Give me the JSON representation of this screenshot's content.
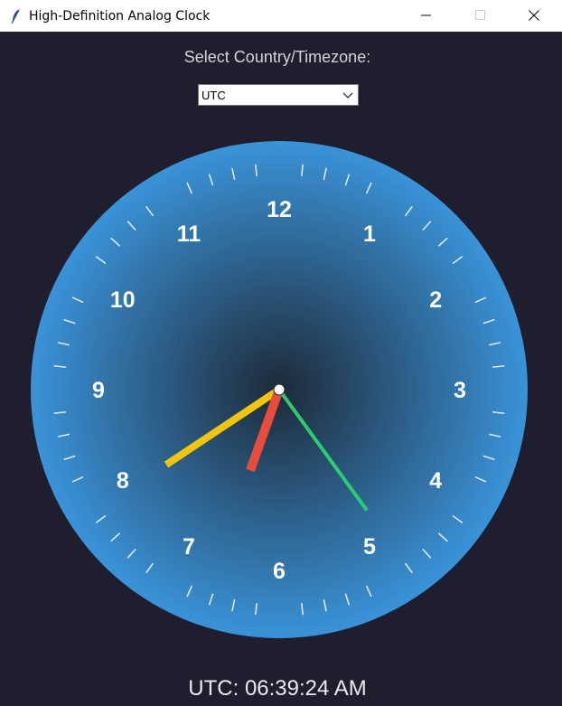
{
  "window": {
    "title": "High-Definition Analog Clock",
    "icon": "feather-icon"
  },
  "timezone": {
    "label": "Select Country/Timezone:",
    "selected": "UTC"
  },
  "clock": {
    "numerals": [
      "12",
      "1",
      "2",
      "3",
      "4",
      "5",
      "6",
      "7",
      "8",
      "9",
      "10",
      "11"
    ],
    "hour": 6,
    "minute": 39,
    "second": 24,
    "colors": {
      "background": "#1e1e2e",
      "face_edge": "#3a93d8",
      "face_center": "#1e2a38",
      "hour_hand": "#e74c3c",
      "minute_hand": "#f1c40f",
      "second_hand": "#2ecc71",
      "ticks": "#dfe6ee",
      "numerals": "#ffffff"
    }
  },
  "readout": "UTC: 06:39:24 AM"
}
